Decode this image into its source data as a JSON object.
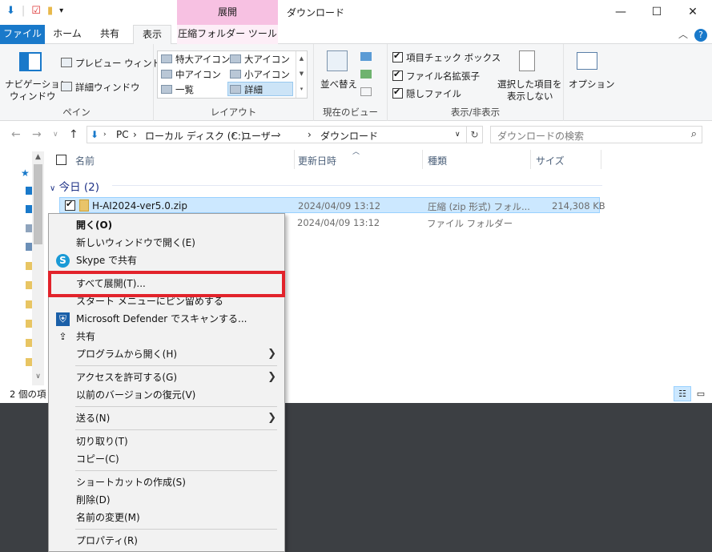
{
  "window": {
    "title": "ダウンロード",
    "context_group": "展開",
    "controls": {
      "minimize": "—",
      "maximize": "☐",
      "close": "✕"
    }
  },
  "tabs": {
    "file": "ファイル",
    "home": "ホーム",
    "share": "共有",
    "view": "表示",
    "compressed_tools": "圧縮フォルダー ツール",
    "collapse": "︿",
    "help": "?"
  },
  "ribbon": {
    "pane": {
      "nav_pane_line1": "ナビゲーション",
      "nav_pane_line2": "ウィンドウ",
      "preview": "プレビュー ウィンドウ",
      "details": "詳細ウィンドウ",
      "label": "ペイン"
    },
    "layout": {
      "items": [
        "特大アイコン",
        "大アイコン",
        "中アイコン",
        "小アイコン",
        "一覧",
        "詳細"
      ],
      "selected": "詳細",
      "label": "レイアウト"
    },
    "current_view": {
      "sort": "並べ替え",
      "label": "現在のビュー"
    },
    "show_hide": {
      "item_checkbox": "項目チェック ボックス",
      "file_ext": "ファイル名拡張子",
      "hidden": "隠しファイル",
      "hide_selected_line1": "選択した項目を",
      "hide_selected_line2": "表示しない",
      "label": "表示/非表示"
    },
    "options": {
      "label": "オプション"
    }
  },
  "address": {
    "crumbs": [
      "PC",
      "ローカル ディスク (C:)",
      "ユーザー",
      "ダウンロード"
    ],
    "search_placeholder": "ダウンロードの検索"
  },
  "columns": [
    "名前",
    "更新日時",
    "種類",
    "サイズ"
  ],
  "group": {
    "label": "今日 (2)"
  },
  "files": [
    {
      "name": "H-AI2024-ver5.0.zip",
      "modified": "2024/04/09 13:12",
      "type": "圧縮 (zip 形式) フォル...",
      "size": "214,308 KB"
    },
    {
      "name": "",
      "modified": "2024/04/09 13:12",
      "type": "ファイル フォルダー",
      "size": ""
    }
  ],
  "status": {
    "count": "2 個の項"
  },
  "context_menu": {
    "open": "開く(O)",
    "open_new_window": "新しいウィンドウで開く(E)",
    "skype_share": "Skype で共有",
    "extract_all": "すべて展開(T)...",
    "pin_start": "スタート メニューにピン留めする",
    "defender_scan": "Microsoft Defender でスキャンする...",
    "share": "共有",
    "open_with": "プログラムから開く(H)",
    "give_access": "アクセスを許可する(G)",
    "restore_versions": "以前のバージョンの復元(V)",
    "send_to": "送る(N)",
    "cut": "切り取り(T)",
    "copy": "コピー(C)",
    "create_shortcut": "ショートカットの作成(S)",
    "delete": "削除(D)",
    "rename": "名前の変更(M)",
    "properties": "プロパティ(R)"
  }
}
